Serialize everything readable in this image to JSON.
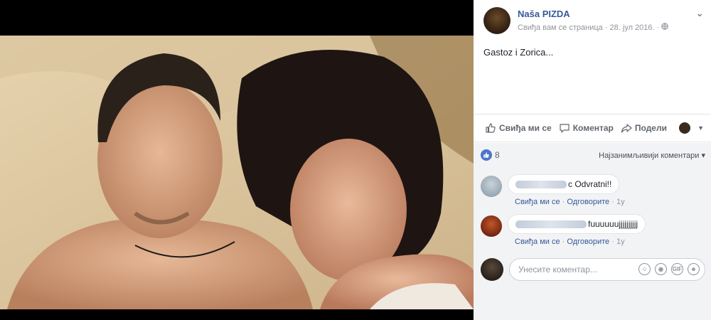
{
  "post": {
    "page_name": "Naša PIZDA",
    "meta": "Свиђа вам се страница · 28. јул 2016. ·",
    "privacy_icon": "globe-icon",
    "text": "Gastoz i Zorica..."
  },
  "actions": {
    "like": "Свиђа ми се",
    "comment": "Коментар",
    "share": "Подели"
  },
  "reactions": {
    "count": "8",
    "sort_label": "Најзанимљивији коментари ▾"
  },
  "comments": [
    {
      "text": "c Odvratni!!",
      "like": "Свиђа ми се",
      "reply": "Одговорите",
      "age": "1y"
    },
    {
      "text": "fuuuuuujjjjjjjjjj",
      "like": "Свиђа ми се",
      "reply": "Одговорите",
      "age": "1y"
    }
  ],
  "composer": {
    "placeholder": "Унесите коментар..."
  },
  "colors": {
    "link": "#365899",
    "like_blue": "#4a76c8",
    "muted": "#90949c"
  }
}
